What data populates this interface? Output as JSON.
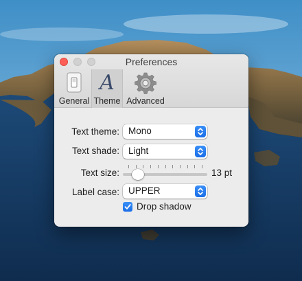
{
  "window": {
    "title": "Preferences",
    "tabs": [
      {
        "label": "General",
        "selected": false
      },
      {
        "label": "Theme",
        "selected": true
      },
      {
        "label": "Advanced",
        "selected": false
      }
    ]
  },
  "form": {
    "text_theme": {
      "label": "Text theme:",
      "value": "Mono"
    },
    "text_shade": {
      "label": "Text shade:",
      "value": "Light"
    },
    "text_size": {
      "label": "Text size:",
      "value": "13",
      "unit": "13 pt",
      "slider_fraction": 0.13,
      "tick_count": 11
    },
    "label_case": {
      "label": "Label case:",
      "value": "UPPER"
    },
    "drop_shadow": {
      "label": "Drop shadow",
      "checked": true
    }
  },
  "colors": {
    "accent": "#1f72ec",
    "close_button": "#fd5f57",
    "window_bg": "#ececec"
  },
  "icons": {
    "general": "light-switch-icon",
    "theme": "italic-a-icon",
    "advanced": "gear-icon"
  }
}
